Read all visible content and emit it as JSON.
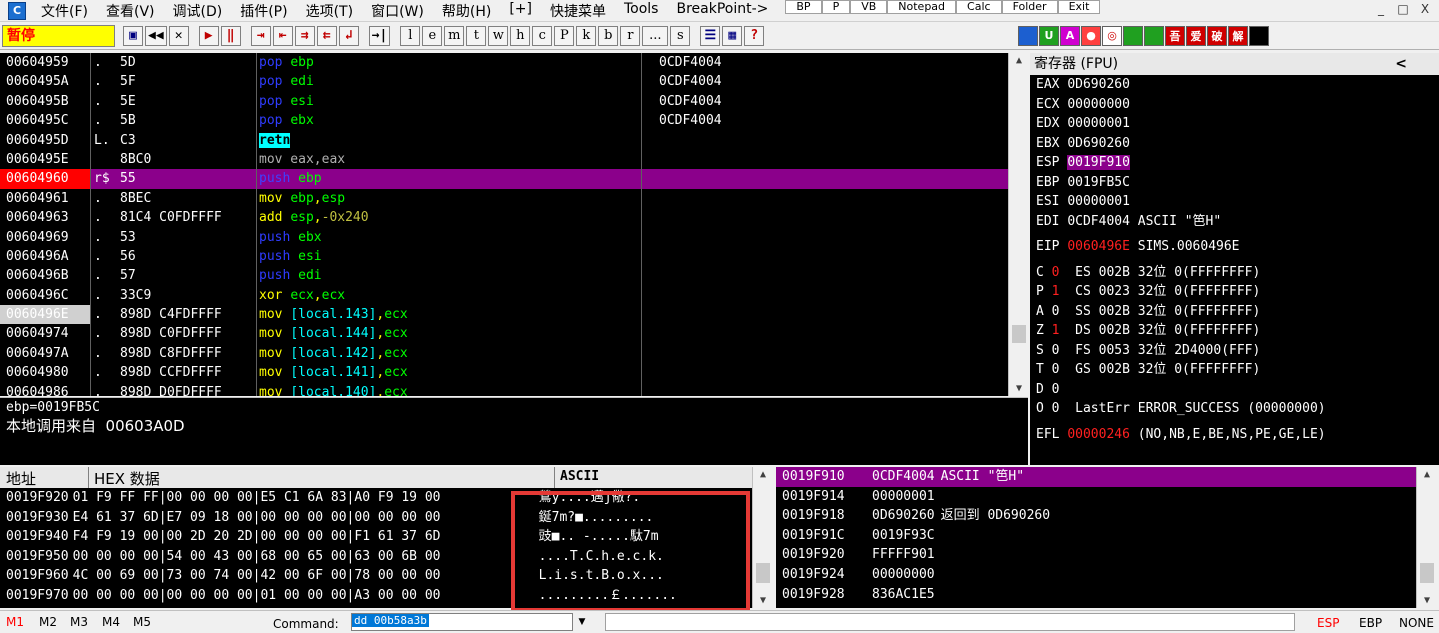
{
  "menu": {
    "items": [
      "文件(F)",
      "查看(V)",
      "调试(D)",
      "插件(P)",
      "选项(T)",
      "窗口(W)",
      "帮助(H)",
      "[+]",
      "快捷菜单",
      "Tools",
      "BreakPoint->"
    ],
    "quick_tabs": [
      "BP",
      "P",
      "VB",
      "Notepad",
      "Calc",
      "Folder",
      "Exit"
    ],
    "window_buttons": [
      "_",
      "□",
      "X"
    ]
  },
  "toolbar": {
    "status": "暂停",
    "run_buttons": [
      "▶",
      "‖"
    ],
    "letters": [
      "l",
      "e",
      "m",
      "t",
      "w",
      "h",
      "c",
      "P",
      "k",
      "b",
      "r",
      "...",
      "s"
    ],
    "color_buttons": [
      {
        "label": "",
        "color": "#1c5fd0"
      },
      {
        "label": "U",
        "color": "#20a020"
      },
      {
        "label": "A",
        "color": "#d000d0"
      },
      {
        "label": "●",
        "color": "#ff4040"
      },
      {
        "label": "◎",
        "color": "#ffffff"
      },
      {
        "label": "",
        "color": "#20a020"
      },
      {
        "label": "",
        "color": "#20a020"
      },
      {
        "label": "吾",
        "color": "#d00000"
      },
      {
        "label": "爱",
        "color": "#d00000"
      },
      {
        "label": "破",
        "color": "#d00000"
      },
      {
        "label": "解",
        "color": "#d00000"
      },
      {
        "label": "",
        "color": "#000000"
      }
    ]
  },
  "disasm": {
    "rows": [
      {
        "addr": "00604959",
        "flag": ".",
        "hex": "5D",
        "asm": [
          [
            "pop ",
            "blue"
          ],
          [
            "ebp",
            "green"
          ]
        ],
        "cmt": "0CDF4004"
      },
      {
        "addr": "0060495A",
        "flag": ".",
        "hex": "5F",
        "asm": [
          [
            "pop ",
            "blue"
          ],
          [
            "edi",
            "green"
          ]
        ],
        "cmt": "0CDF4004"
      },
      {
        "addr": "0060495B",
        "flag": ".",
        "hex": "5E",
        "asm": [
          [
            "pop ",
            "blue"
          ],
          [
            "esi",
            "green"
          ]
        ],
        "cmt": "0CDF4004"
      },
      {
        "addr": "0060495C",
        "flag": ".",
        "hex": "5B",
        "asm": [
          [
            "pop ",
            "blue"
          ],
          [
            "ebx",
            "green"
          ]
        ],
        "cmt": "0CDF4004"
      },
      {
        "addr": "0060495D",
        "flag": "L.",
        "hex": "C3",
        "asm": [
          [
            "retn",
            "retn"
          ]
        ],
        "cmt": ""
      },
      {
        "addr": "0060495E",
        "flag": "",
        "hex": "8BC0",
        "asm": [
          [
            "mov eax,eax",
            "gray"
          ]
        ],
        "cmt": ""
      },
      {
        "addr": "00604960",
        "flag": "r$",
        "hex": "55",
        "asm": [
          [
            "push ",
            "push"
          ],
          [
            "ebp",
            "green"
          ]
        ],
        "cmt": "",
        "highlight": true,
        "addr_style": "red"
      },
      {
        "addr": "00604961",
        "flag": ".",
        "hex": "8BEC",
        "asm": [
          [
            "mov ",
            "yellow"
          ],
          [
            "ebp",
            "green"
          ],
          [
            ",",
            "yellow"
          ],
          [
            "esp",
            "green"
          ]
        ],
        "cmt": ""
      },
      {
        "addr": "00604963",
        "flag": ".",
        "hex": "81C4 C0FDFFFF",
        "asm": [
          [
            "add ",
            "yellow"
          ],
          [
            "esp",
            "green"
          ],
          [
            ",",
            "yellow"
          ],
          [
            "-0x240",
            "olive"
          ]
        ],
        "cmt": ""
      },
      {
        "addr": "00604969",
        "flag": ".",
        "hex": "53",
        "asm": [
          [
            "push ",
            "blue"
          ],
          [
            "ebx",
            "green"
          ]
        ],
        "cmt": ""
      },
      {
        "addr": "0060496A",
        "flag": ".",
        "hex": "56",
        "asm": [
          [
            "push ",
            "blue"
          ],
          [
            "esi",
            "green"
          ]
        ],
        "cmt": ""
      },
      {
        "addr": "0060496B",
        "flag": ".",
        "hex": "57",
        "asm": [
          [
            "push ",
            "blue"
          ],
          [
            "edi",
            "green"
          ]
        ],
        "cmt": ""
      },
      {
        "addr": "0060496C",
        "flag": ".",
        "hex": "33C9",
        "asm": [
          [
            "xor ",
            "yellow"
          ],
          [
            "ecx",
            "green"
          ],
          [
            ",",
            "yellow"
          ],
          [
            "ecx",
            "green"
          ]
        ],
        "cmt": ""
      },
      {
        "addr": "0060496E",
        "flag": ".",
        "hex": "898D C4FDFFFF",
        "asm": [
          [
            "mov ",
            "yellow"
          ],
          [
            "[local.143]",
            "cyan"
          ],
          [
            ",",
            "yellow"
          ],
          [
            "ecx",
            "green"
          ]
        ],
        "cmt": "",
        "addr_style": "cur"
      },
      {
        "addr": "00604974",
        "flag": ".",
        "hex": "898D C0FDFFFF",
        "asm": [
          [
            "mov ",
            "yellow"
          ],
          [
            "[local.144]",
            "cyan"
          ],
          [
            ",",
            "yellow"
          ],
          [
            "ecx",
            "green"
          ]
        ],
        "cmt": ""
      },
      {
        "addr": "0060497A",
        "flag": ".",
        "hex": "898D C8FDFFFF",
        "asm": [
          [
            "mov ",
            "yellow"
          ],
          [
            "[local.142]",
            "cyan"
          ],
          [
            ",",
            "yellow"
          ],
          [
            "ecx",
            "green"
          ]
        ],
        "cmt": ""
      },
      {
        "addr": "00604980",
        "flag": ".",
        "hex": "898D CCFDFFFF",
        "asm": [
          [
            "mov ",
            "yellow"
          ],
          [
            "[local.141]",
            "cyan"
          ],
          [
            ",",
            "yellow"
          ],
          [
            "ecx",
            "green"
          ]
        ],
        "cmt": ""
      },
      {
        "addr": "00604986",
        "flag": ".",
        "hex": "898D D0FDFFFF",
        "asm": [
          [
            "mov ",
            "yellow"
          ],
          [
            "[local.140]",
            "cyan"
          ],
          [
            ",",
            "yellow"
          ],
          [
            "ecx",
            "green"
          ]
        ],
        "cmt": ""
      }
    ]
  },
  "info": {
    "line1": "ebp=0019FB5C",
    "line2": "本地调用来自  00603A0D"
  },
  "registers": {
    "title": "寄存器 (FPU)",
    "collapse": "<",
    "gp": [
      {
        "name": "EAX",
        "val": "0D690260",
        "extra": ""
      },
      {
        "name": "ECX",
        "val": "00000000",
        "extra": ""
      },
      {
        "name": "EDX",
        "val": "00000001",
        "extra": ""
      },
      {
        "name": "EBX",
        "val": "0D690260",
        "extra": ""
      },
      {
        "name": "ESP",
        "val": "0019F910",
        "extra": "",
        "hl": true
      },
      {
        "name": "EBP",
        "val": "0019FB5C",
        "extra": ""
      },
      {
        "name": "ESI",
        "val": "00000001",
        "extra": ""
      },
      {
        "name": "EDI",
        "val": "0CDF4004",
        "extra": "ASCII \"笆H\""
      }
    ],
    "eip": {
      "name": "EIP",
      "val": "0060496E",
      "extra": "SIMS.0060496E"
    },
    "flags": [
      {
        "f": "C",
        "v": "0",
        "red": true,
        "seg": "ES 002B 32位 0(FFFFFFFF)"
      },
      {
        "f": "P",
        "v": "1",
        "red": true,
        "seg": "CS 0023 32位 0(FFFFFFFF)"
      },
      {
        "f": "A",
        "v": "0",
        "red": false,
        "seg": "SS 002B 32位 0(FFFFFFFF)"
      },
      {
        "f": "Z",
        "v": "1",
        "red": true,
        "seg": "DS 002B 32位 0(FFFFFFFF)"
      },
      {
        "f": "S",
        "v": "0",
        "red": false,
        "seg": "FS 0053 32位 2D4000(FFF)"
      },
      {
        "f": "T",
        "v": "0",
        "red": false,
        "seg": "GS 002B 32位 0(FFFFFFFF)"
      },
      {
        "f": "D",
        "v": "0",
        "red": false,
        "seg": ""
      },
      {
        "f": "O",
        "v": "0",
        "red": false,
        "seg": "LastErr ERROR_SUCCESS (00000000)"
      }
    ],
    "efl": {
      "name": "EFL",
      "val": "00000246",
      "extra": "(NO,NB,E,BE,NS,PE,GE,LE)"
    }
  },
  "dump": {
    "headers": {
      "addr": "地址",
      "hex": "HEX 数据",
      "ascii": "ASCII"
    },
    "rows": [
      {
        "addr": "0019F920",
        "hex": "01 F9 FF FF|00 00 00 00|E5 C1 6A 83|A0 F9 19 00",
        "ascii": "鶯y....邁j儆?."
      },
      {
        "addr": "0019F930",
        "hex": "E4 61 37 6D|E7 09 18 00|00 00 00 00|00 00 00 00",
        "ascii": "鋋7m?■........."
      },
      {
        "addr": "0019F940",
        "hex": "F4 F9 19 00|00 2D 20 2D|00 00 00 00|F1 61 37 6D",
        "ascii": "豉■.. -.....駄7m"
      },
      {
        "addr": "0019F950",
        "hex": "00 00 00 00|54 00 43 00|68 00 65 00|63 00 6B 00",
        "ascii": "....T.C.h.e.c.k."
      },
      {
        "addr": "0019F960",
        "hex": "4C 00 69 00|73 00 74 00|42 00 6F 00|78 00 00 00",
        "ascii": "L.i.s.t.B.o.x..."
      },
      {
        "addr": "0019F970",
        "hex": "00 00 00 00|00 00 00 00|01 00 00 00|A3 00 00 00",
        "ascii": ".........￡......."
      }
    ]
  },
  "stack": {
    "rows": [
      {
        "addr": "0019F910",
        "val": "0CDF4004",
        "cmt": "ASCII \"笆H\"",
        "hl": true
      },
      {
        "addr": "0019F914",
        "val": "00000001",
        "cmt": ""
      },
      {
        "addr": "0019F918",
        "val": "0D690260",
        "cmt": "返回到 0D690260"
      },
      {
        "addr": "0019F91C",
        "val": "0019F93C",
        "cmt": ""
      },
      {
        "addr": "0019F920",
        "val": "FFFFF901",
        "cmt": ""
      },
      {
        "addr": "0019F924",
        "val": "00000000",
        "cmt": ""
      },
      {
        "addr": "0019F928",
        "val": "836AC1E5",
        "cmt": ""
      }
    ]
  },
  "bottombar": {
    "marks": [
      "M1",
      "M2",
      "M3",
      "M4",
      "M5"
    ],
    "command_label": "Command:",
    "command_value": "dd 00b58a3b",
    "regs": [
      "ESP",
      "EBP",
      "NONE"
    ]
  }
}
